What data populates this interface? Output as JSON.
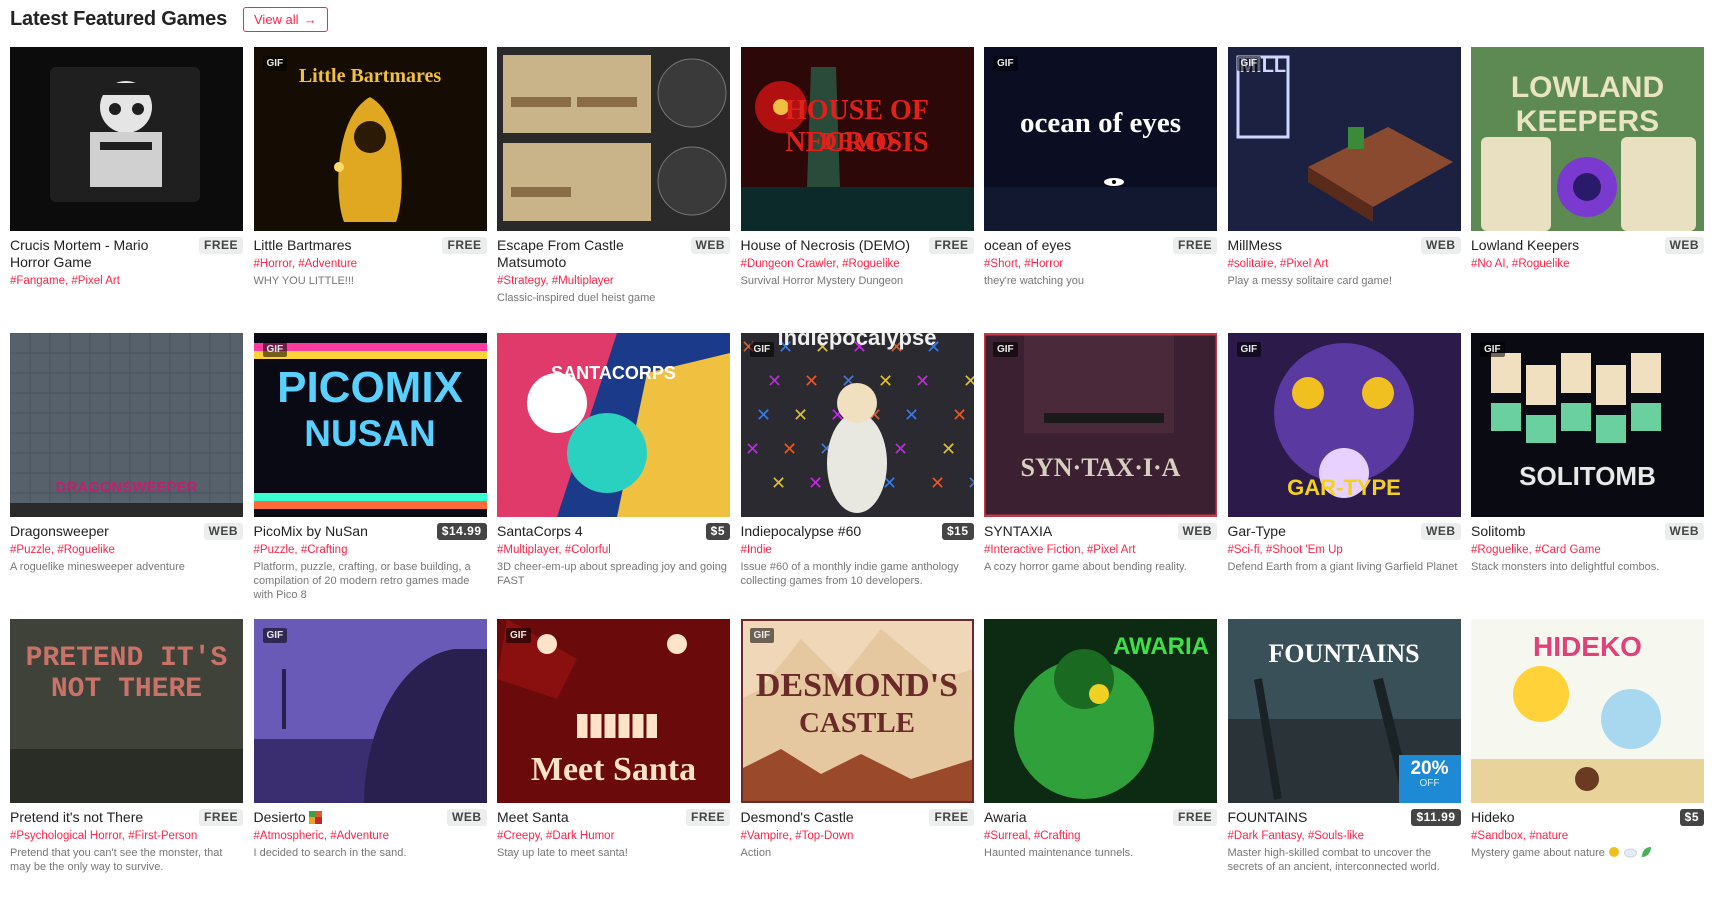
{
  "header": {
    "title": "Latest Featured Games",
    "view_all": "View all",
    "arrow": "→"
  },
  "games": [
    {
      "title": "Crucis Mortem - Mario Horror Game",
      "price": "FREE",
      "paid": false,
      "gif": false,
      "tags": [
        "#Fangame",
        "#Pixel Art"
      ],
      "desc": "",
      "thumb_text": "",
      "bg": "#111111",
      "thumb_color": "#eeeeee"
    },
    {
      "title": "Little Bartmares",
      "price": "FREE",
      "paid": false,
      "gif": true,
      "tags": [
        "#Horror",
        "#Adventure"
      ],
      "desc": "WHY YOU LITTLE!!!",
      "thumb_text": "Little Bartmares",
      "bg": "#1a1108",
      "thumb_color": "#f0c040"
    },
    {
      "title": "Escape From Castle Matsumoto",
      "price": "WEB",
      "paid": false,
      "gif": false,
      "tags": [
        "#Strategy",
        "#Multiplayer"
      ],
      "desc": "Classic-inspired duel heist game",
      "thumb_text": "",
      "bg": "#2b2b2b",
      "thumb_color": "#c9b48a"
    },
    {
      "title": "House of Necrosis (DEMO)",
      "price": "FREE",
      "paid": false,
      "gif": false,
      "tags": [
        "#Dungeon Crawler",
        "#Roguelike"
      ],
      "desc": "Survival Horror Mystery Dungeon",
      "thumb_text": "HOUSE OF NECROSIS",
      "thumb_sub": "DEMO",
      "bg": "#1a0606",
      "thumb_color": "#e0201a"
    },
    {
      "title": "ocean of eyes",
      "price": "FREE",
      "paid": false,
      "gif": true,
      "tags": [
        "#Short",
        "#Horror"
      ],
      "desc": "they're watching you",
      "thumb_text": "ocean of eyes",
      "bg": "#0b0e22",
      "thumb_color": "#ffffff"
    },
    {
      "title": "MillMess",
      "price": "WEB",
      "paid": false,
      "gif": true,
      "tags": [
        "#solitaire",
        "#Pixel Art"
      ],
      "desc": "Play a messy solitaire card game!",
      "thumb_text": "MILL",
      "bg": "#1c2142",
      "thumb_color": "#cfd6ff"
    },
    {
      "title": "Lowland Keepers",
      "price": "WEB",
      "paid": false,
      "gif": false,
      "tags": [
        "#No AI",
        "#Roguelike"
      ],
      "desc": "",
      "thumb_text": "LOWLAND KEEPERS",
      "bg": "#7aa56a",
      "thumb_color": "#e9e4c2"
    },
    {
      "title": "Dragonsweeper",
      "price": "WEB",
      "paid": false,
      "gif": false,
      "tags": [
        "#Puzzle",
        "#Roguelike"
      ],
      "desc": "A roguelike minesweeper adventure",
      "thumb_text": "DRAGONSWEEPER",
      "bg": "#4b5560",
      "thumb_color": "#c02070"
    },
    {
      "title": "PicoMix by NuSan",
      "price": "$14.99",
      "paid": true,
      "gif": true,
      "tags": [
        "#Puzzle",
        "#Crafting"
      ],
      "desc": "Platform, puzzle, crafting, or base building, a compilation of 20 modern retro games made with Pico 8",
      "thumb_text": "PICOMIX",
      "thumb_sub": "NUSAN",
      "bg": "#0a0a14",
      "thumb_color": "#5ad0ff"
    },
    {
      "title": "SantaCorps 4",
      "price": "$5",
      "paid": true,
      "gif": false,
      "tags": [
        "#Multiplayer",
        "#Colorful"
      ],
      "desc": "3D cheer-em-up about spreading joy and going FAST",
      "thumb_text": "SANTACORPS",
      "bg": "#1c3a8a",
      "thumb_color": "#ffffff"
    },
    {
      "title": "Indiepocalypse #60",
      "price": "$15",
      "paid": true,
      "gif": true,
      "tags": [
        "#Indie"
      ],
      "desc": "Issue #60 of a monthly indie game anthology collecting games from 10 developers.",
      "thumb_text": "indiepocalypse",
      "bg": "#2a2a30",
      "thumb_color": "#f0f0f0"
    },
    {
      "title": "SYNTAXIA",
      "price": "WEB",
      "paid": false,
      "gif": true,
      "tags": [
        "#Interactive Fiction",
        "#Pixel Art"
      ],
      "desc": "A cozy horror game about bending reality.",
      "thumb_text": "SYN·TAX·I·A",
      "bg": "#3a2030",
      "thumb_color": "#d8cfc0"
    },
    {
      "title": "Gar-Type",
      "price": "WEB",
      "paid": false,
      "gif": true,
      "tags": [
        "#Sci-fi",
        "#Shoot 'Em Up"
      ],
      "desc": "Defend Earth from a giant living Garfield Planet",
      "thumb_text": "GAR-TYPE",
      "bg": "#2b1a4a",
      "thumb_color": "#f2d21a"
    },
    {
      "title": "Solitomb",
      "price": "WEB",
      "paid": false,
      "gif": true,
      "tags": [
        "#Roguelike",
        "#Card Game"
      ],
      "desc": "Stack monsters into delightful combos.",
      "thumb_text": "SOLITOMB",
      "bg": "#0a0a12",
      "thumb_color": "#e8e8e8"
    },
    {
      "title": "Pretend it's not There",
      "price": "FREE",
      "paid": false,
      "gif": false,
      "tags": [
        "#Psychological Horror",
        "#First-Person"
      ],
      "desc": "Pretend that you can't see the monster, that may be the only way to survive.",
      "thumb_text": "PRETEND IT'S NOT THERE",
      "bg": "#3e4238",
      "thumb_color": "#c8726a"
    },
    {
      "title": "Desierto",
      "price": "WEB",
      "paid": false,
      "gif": true,
      "tags": [
        "#Atmospheric",
        "#Adventure"
      ],
      "desc": "I decided to search in the sand.",
      "thumb_text": "",
      "bg": "#4a3f88",
      "thumb_color": "#c9b8f0"
    },
    {
      "title": "Meet Santa",
      "price": "FREE",
      "paid": false,
      "gif": true,
      "tags": [
        "#Creepy",
        "#Dark Humor"
      ],
      "desc": "Stay up late to meet santa!",
      "thumb_text": "Meet Santa",
      "bg": "#6a0a0a",
      "thumb_color": "#ffe3c8"
    },
    {
      "title": "Desmond's Castle",
      "price": "FREE",
      "paid": false,
      "gif": true,
      "tags": [
        "#Vampire",
        "#Top-Down"
      ],
      "desc": "Action",
      "thumb_text": "DESMOND'S",
      "thumb_sub": "CASTLE",
      "bg": "#efd7b8",
      "thumb_color": "#6a2a2a"
    },
    {
      "title": "Awaria",
      "price": "FREE",
      "paid": false,
      "gif": false,
      "tags": [
        "#Surreal",
        "#Crafting"
      ],
      "desc": "Haunted maintenance tunnels.",
      "thumb_text": "AWARIA",
      "bg": "#0d2a12",
      "thumb_color": "#3ee04a"
    },
    {
      "title": "FOUNTAINS",
      "price": "$11.99",
      "paid": true,
      "gif": false,
      "tags": [
        "#Dark Fantasy",
        "#Souls-like"
      ],
      "desc": "Master high-skilled combat to uncover the secrets of an ancient, interconnected world.",
      "thumb_text": "FOUNTAINS",
      "sale_pct": "20%",
      "sale_off": "OFF",
      "bg": "#2a3a40",
      "thumb_color": "#ffffff"
    },
    {
      "title": "Hideko",
      "price": "$5",
      "paid": true,
      "gif": false,
      "tags": [
        "#Sandbox",
        "#nature"
      ],
      "desc": "Mystery game about nature",
      "thumb_text": "HIDEKO",
      "bg": "#f3f7ea",
      "thumb_color": "#e2407a"
    }
  ],
  "icons": {
    "arrow": "arrow-right-icon",
    "sun": "sun-emoji-icon",
    "cloud": "cloud-emoji-icon",
    "leaf": "leaf-emoji-icon",
    "desierto": "colorblock-emoji-icon"
  },
  "colors": {
    "accent": "#ff2449",
    "badge_bg": "#eceded",
    "sale_bg": "#1e8ad6",
    "tag": "#ff2449"
  }
}
